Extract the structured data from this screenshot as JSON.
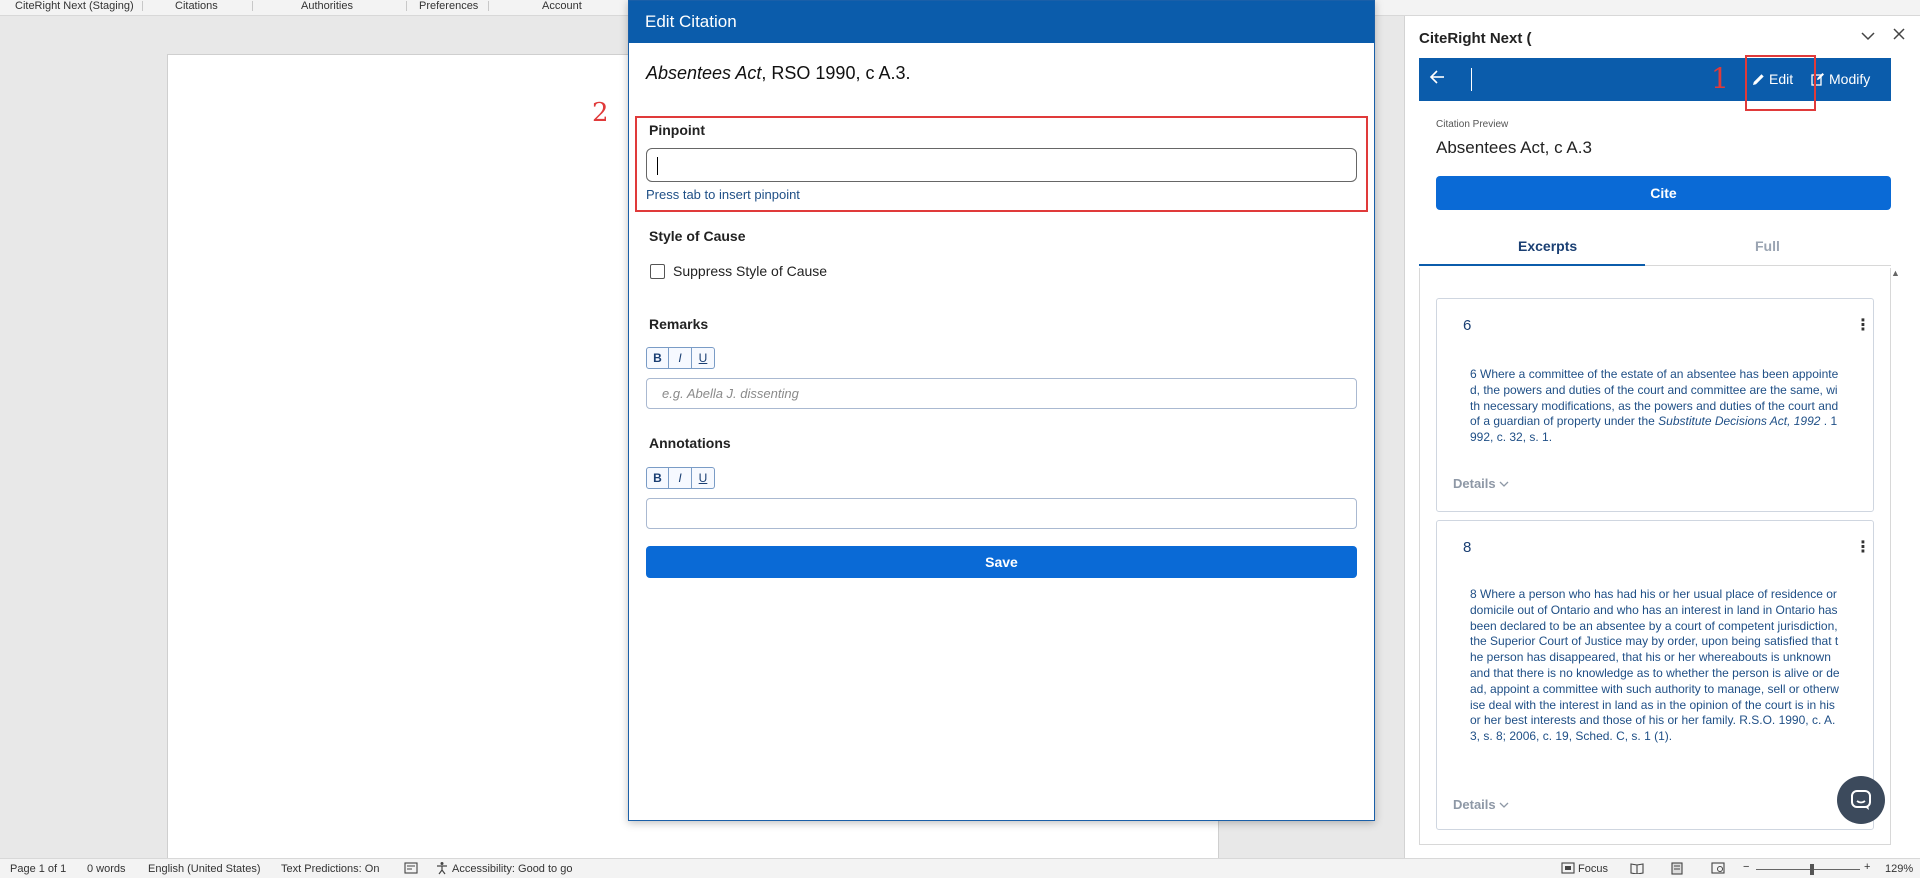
{
  "ribbon": {
    "tabs": [
      "CiteRight Next (Staging)",
      "Citations",
      "Authorities",
      "Preferences",
      "Account"
    ]
  },
  "dialog": {
    "title": "Edit Citation",
    "citation_name": "Absentees Act",
    "citation_rest": ", RSO 1990, c A.3.",
    "pinpoint_label": "Pinpoint",
    "pinpoint_value": "",
    "pinpoint_hint": "Press tab to insert pinpoint",
    "style_of_cause_label": "Style of Cause",
    "suppress_label": "Suppress Style of Cause",
    "remarks_label": "Remarks",
    "remarks_placeholder": "e.g. Abella J. dissenting",
    "annotations_label": "Annotations",
    "format_bold": "B",
    "format_italic": "I",
    "format_underline": "U",
    "save_label": "Save"
  },
  "annotations": {
    "marker_1": "1",
    "marker_2": "2",
    "color": "#e03a3a"
  },
  "pane": {
    "title": "CiteRight Next (",
    "toolbar": {
      "edit_label": "Edit",
      "modify_label": "Modify"
    },
    "preview_label": "Citation Preview",
    "preview_text": "Absentees Act, c A.3",
    "cite_label": "Cite",
    "tabs": [
      "Excerpts",
      "Full"
    ],
    "excerpts": [
      {
        "number": "6",
        "text_before": "6 Where a committee of the estate of an absentee has been appointed, the powers and duties of the court and committee are the same, with necessary modifications, as the powers and duties of the court and of a guardian of property under the ",
        "text_italic": "Substitute Decisions Act, 1992",
        "text_after": " . 1992, c. 32, s. 1.",
        "details_label": "Details"
      },
      {
        "number": "8",
        "text_before": "8 Where a person who has had his or her usual place of residence or domicile out of Ontario and who has an interest in land in Ontario has been declared to be an absentee by a court of competent jurisdiction, the Superior Court of Justice may by order, upon being satisfied that the person has disappeared, that his or her whereabouts is unknown and that there is no knowledge as to whether the person is alive or dead, appoint a committee with such authority to manage, sell or otherwise deal with the interest in land as in the opinion of the court is in his or her best interests and those of his or her family.  R.S.O. 1990, c. A.3, s. 8; 2006, c. 19, Sched. C, s. 1 (1).",
        "text_italic": "",
        "text_after": "",
        "details_label": "Details"
      }
    ]
  },
  "statusbar": {
    "page": "Page 1 of 1",
    "words": "0 words",
    "language": "English (United States)",
    "predictions": "Text Predictions: On",
    "accessibility": "Accessibility: Good to go",
    "focus": "Focus",
    "zoom_minus": "−",
    "zoom_plus": "+",
    "zoom": "129%"
  }
}
